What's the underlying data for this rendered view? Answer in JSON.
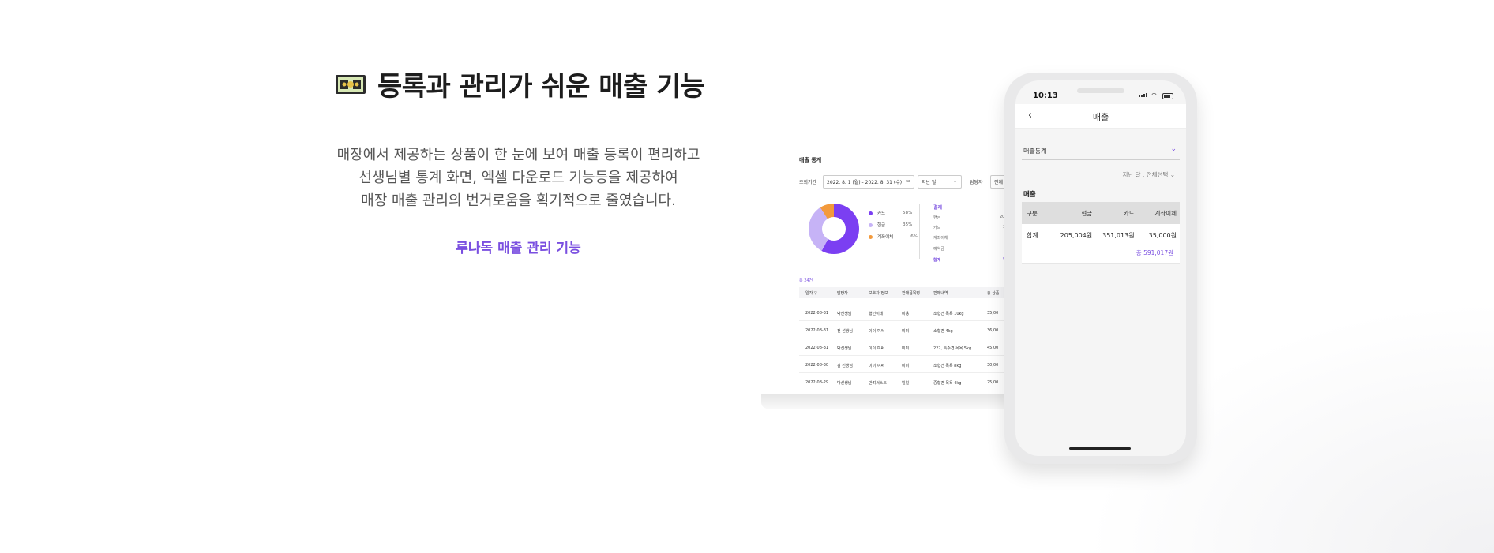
{
  "headline": {
    "icon": "money-banknote-icon",
    "text": "등록과 관리가 쉬운 매출 기능"
  },
  "description": [
    "매장에서 제공하는 상품이 한 눈에 보여 매출 등록이 편리하고",
    "선생님별 통계 화면, 엑셀 다운로드 기능등을 제공하여",
    "매장 매출 관리의 번거로움을 획기적으로 줄였습니다."
  ],
  "link_label": "루나독 매출 관리 기능",
  "desktop": {
    "title": "매출 통계",
    "filter_label": "조회기간",
    "date_range": "2022. 8. 1 (월) - 2022. 8. 31 (수)",
    "period_select": "지난 달",
    "staff_label": "담당자",
    "staff_select": "전체",
    "legend": [
      {
        "label": "카드",
        "pct": "58%",
        "color": "#7b3ff2"
      },
      {
        "label": "현금",
        "pct": "35%",
        "color": "#c6b3f6"
      },
      {
        "label": "계좌이체",
        "pct": "6%",
        "color": "#f39a3c"
      }
    ],
    "payment_header": "결제",
    "payment_rows": [
      "현금",
      "카드",
      "계좌이체",
      "예약금"
    ],
    "payment_values": [
      "20",
      "3",
      "",
      ""
    ],
    "payment_total_label": "합계",
    "payment_total_value": "5",
    "count_text": "총 24건",
    "columns": [
      "일자 ▽",
      "담당자",
      "보호자 정보",
      "판매품목명",
      "판매내역",
      "총 상품"
    ],
    "rows": [
      [
        "2022-08-31",
        "박선생님",
        "행인이네",
        "미용",
        "소형견 목욕 10kg",
        "35,00"
      ],
      [
        "2022-08-31",
        "전 선생님",
        "이이 여써",
        "미미",
        "소형견 4kg",
        "36,00"
      ],
      [
        "2022-08-31",
        "박선생님",
        "이이 여써",
        "미미",
        "222, 특수견 목욕 5kg",
        "45,00"
      ],
      [
        "2022-08-30",
        "김 선생님",
        "이이 여써",
        "미미",
        "소형견 목욕 8kg",
        "30,00"
      ],
      [
        "2022-08-29",
        "박선생님",
        "반려써스트",
        "일일",
        "중형견 목욕 4kg",
        "25,00"
      ]
    ]
  },
  "phone": {
    "time": "10:13",
    "title": "매출",
    "back_icon": "chevron-left-icon",
    "select_value": "매출통계",
    "period_text": "지난 달 , 전체선택",
    "section_title": "매출",
    "table_headers": [
      "구분",
      "현금",
      "카드",
      "계좌이체"
    ],
    "table_row": [
      "합계",
      "205,004원",
      "351,013원",
      "35,000원"
    ],
    "total_text": "총 591,017원"
  },
  "colors": {
    "accent": "#7a4fe0",
    "card": "#7b3ff2",
    "cash": "#c6b3f6",
    "transfer": "#f39a3c"
  }
}
